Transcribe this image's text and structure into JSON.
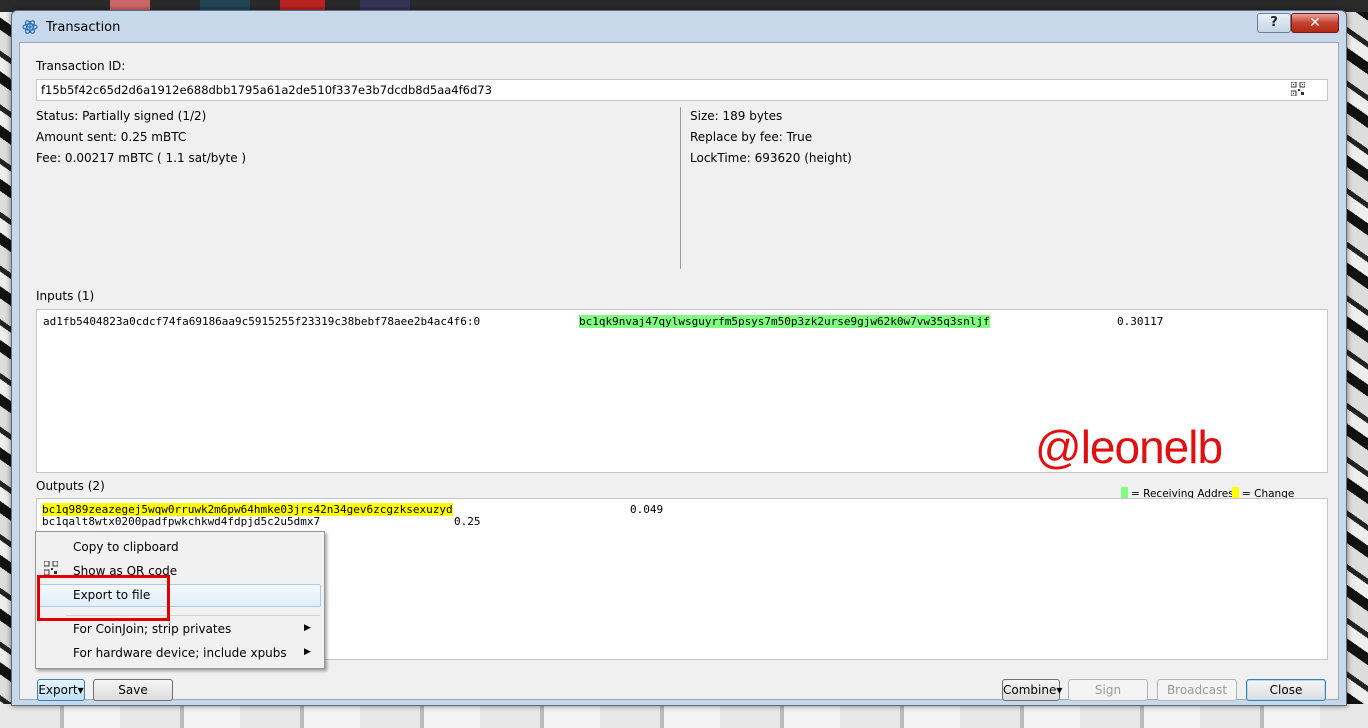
{
  "window": {
    "title": "Transaction",
    "help_label": "?",
    "close_label": "✕"
  },
  "txid": {
    "label": "Transaction ID:",
    "value": "f15b5f42c65d2d6a1912e688dbb1795a61a2de510f337e3b7dcdb8d5aa4f6d73"
  },
  "details_left": {
    "status": "Status: Partially signed (1/2)",
    "amount": "Amount sent: 0.25 mBTC",
    "fee": "Fee: 0.00217 mBTC  ( 1.1 sat/byte )"
  },
  "details_right": {
    "size": "Size: 189 bytes",
    "rbf": "Replace by fee: True",
    "locktime": "LockTime: 693620 (height)"
  },
  "inputs": {
    "label": "Inputs (1)",
    "rows": [
      {
        "outpoint": "ad1fb5404823a0cdcf74fa69186aa9c5915255f23319c38bebf78aee2b4ac4f6:0",
        "address": "bc1qk9nvaj47qylwsguyrfm5psys7m50p3zk2urse9gjw62k0w7vw35q3snljf",
        "amount": "0.30117"
      }
    ]
  },
  "outputs": {
    "label": "Outputs (2)",
    "rows": [
      {
        "address": "bc1q989zeazegej5wqw0rruwk2m6pw64hmke03jrs42n34gev6zcgzksexuzyd",
        "amount": "0.049",
        "type": "change"
      },
      {
        "address": "bc1qalt8wtx0200padfpwkchkwd4fdpjd5c2u5dmx7",
        "amount": "0.25",
        "type": "plain"
      }
    ]
  },
  "legend": {
    "receiving": "= Receiving Address",
    "change": "= Change Address",
    "receiving_color": "#80ff80",
    "change_color": "#ffff00"
  },
  "watermark": "@leonelb",
  "context_menu": {
    "items": [
      "Copy to clipboard",
      "Show as QR code",
      "Export to file",
      "For CoinJoin; strip privates",
      "For hardware device; include xpubs"
    ]
  },
  "buttons": {
    "export": "Export",
    "save": "Save",
    "combine": "Combine",
    "sign": "Sign",
    "broadcast": "Broadcast",
    "close": "Close"
  }
}
